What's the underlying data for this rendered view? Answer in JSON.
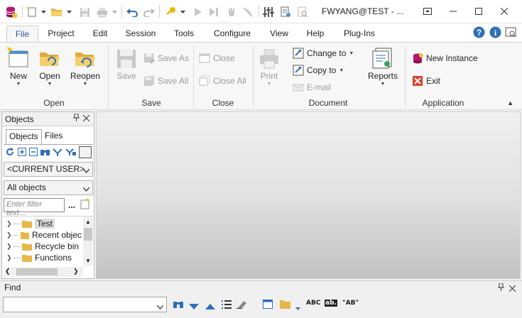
{
  "window": {
    "title": "FWYANG@TEST - ...",
    "accent": "#2b579a"
  },
  "tabs": [
    "File",
    "Project",
    "Edit",
    "Session",
    "Tools",
    "Configure",
    "View",
    "Help",
    "Plug-Ins"
  ],
  "ribbon": {
    "open_group": {
      "label": "Open",
      "new": "New",
      "open": "Open",
      "reopen": "Reopen"
    },
    "save_group": {
      "label": "Save",
      "save": "Save",
      "save_as": "Save As",
      "save_all": "Save All"
    },
    "close_group": {
      "label": "Close",
      "close": "Close",
      "close_all": "Close All"
    },
    "document_group": {
      "label": "Document",
      "print": "Print",
      "change_to": "Change to",
      "copy_to": "Copy to",
      "email": "E-mail",
      "reports": "Reports"
    },
    "application_group": {
      "label": "Application",
      "new_instance": "New Instance",
      "exit": "Exit"
    }
  },
  "objects_panel": {
    "title": "Objects",
    "tabs": [
      "Objects",
      "Files"
    ],
    "user_select": "<CURRENT USER>",
    "objects_select": "All objects",
    "filter_placeholder": "Enter filter text...",
    "filter_more": "...",
    "tree": [
      {
        "label": "Test",
        "selected": true
      },
      {
        "label": "Recent objects",
        "selected": false
      },
      {
        "label": "Recycle bin",
        "selected": false
      },
      {
        "label": "Functions",
        "selected": false
      }
    ]
  },
  "find": {
    "title": "Find",
    "input_value": "",
    "abc_label": "ABC",
    "ab_label": "ab.",
    "quote_label": "\"AB\""
  },
  "icons": [
    "app-database-icon",
    "new-file-icon",
    "open-folder-icon",
    "save-icon",
    "print-icon",
    "undo-icon",
    "redo-icon",
    "key-icon",
    "run-icon",
    "stop-icon",
    "binoculars-icon",
    "help-icon",
    "info-icon"
  ]
}
